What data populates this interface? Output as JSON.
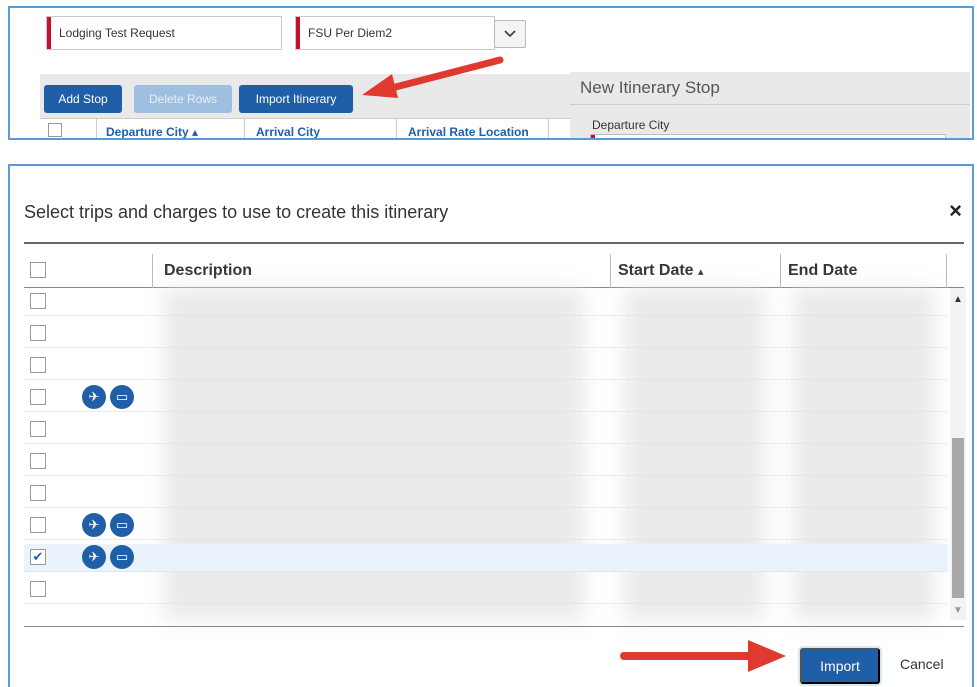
{
  "top": {
    "request_name": "Lodging Test Request",
    "policy": "FSU Per Diem2",
    "buttons": {
      "add_stop": "Add Stop",
      "delete_rows": "Delete Rows",
      "import_itinerary": "Import Itinerary"
    },
    "grid_headers": {
      "departure_city": "Departure City",
      "arrival_city": "Arrival City",
      "arrival_rate_location": "Arrival Rate Location"
    },
    "new_stop": {
      "title": "New Itinerary Stop",
      "departure_city_label": "Departure City"
    }
  },
  "dialog": {
    "title": "Select trips and charges to use to create this itinerary",
    "close_glyph": "×",
    "columns": {
      "description": "Description",
      "start_date": "Start Date",
      "end_date": "End Date"
    },
    "sort_glyph": "▴",
    "rows": [
      {
        "checked": false,
        "icons": false
      },
      {
        "checked": false,
        "icons": false
      },
      {
        "checked": false,
        "icons": false
      },
      {
        "checked": false,
        "icons": true
      },
      {
        "checked": false,
        "icons": false
      },
      {
        "checked": false,
        "icons": false
      },
      {
        "checked": false,
        "icons": false
      },
      {
        "checked": false,
        "icons": true
      },
      {
        "checked": true,
        "icons": true
      },
      {
        "checked": false,
        "icons": false
      }
    ],
    "buttons": {
      "import": "Import",
      "cancel": "Cancel"
    }
  },
  "colors": {
    "accent": "#1f5fa8",
    "frame": "#5b9bd5",
    "arrow": "#e03a30",
    "required": "#c8102e"
  }
}
